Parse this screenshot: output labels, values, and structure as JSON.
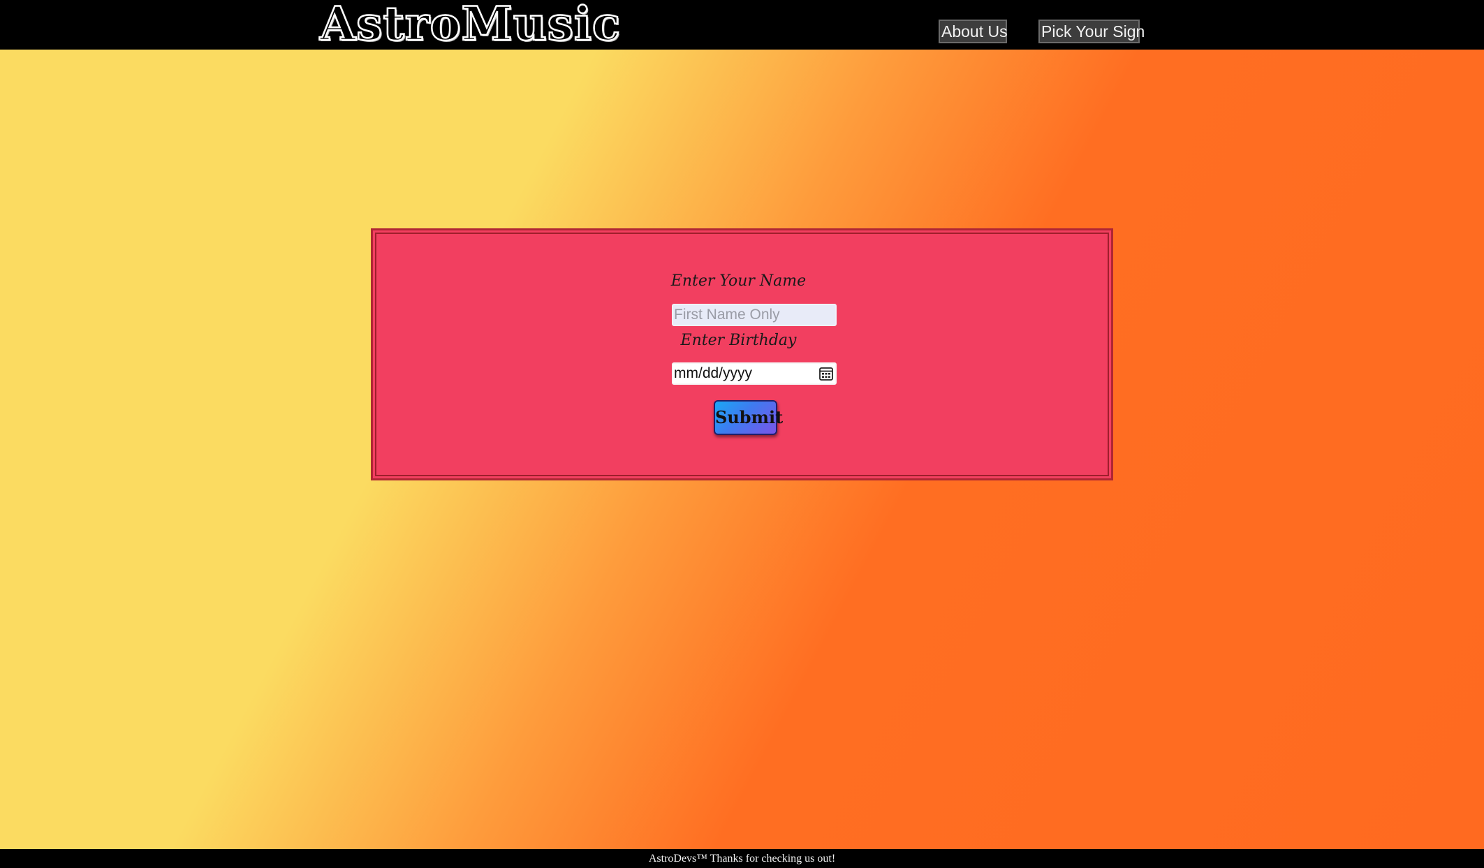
{
  "header": {
    "logo_text": "AstroMusic",
    "nav": {
      "about_label": "About Us",
      "sign_label": "Pick Your Sign"
    }
  },
  "form": {
    "name_label": "Enter Your Name",
    "name_placeholder": "First Name Only",
    "name_value": "",
    "birthday_label": "Enter Birthday",
    "birthday_placeholder": "mm/dd/yyyy",
    "birthday_icon": "calendar-icon",
    "submit_label": "Submit"
  },
  "footer": {
    "text": "AstroDevs™ Thanks for checking us out!"
  },
  "colors": {
    "bar_background": "#000000",
    "page_gradient_start": "#fbdb61",
    "page_gradient_end": "#ff6e22",
    "panel_background": "#f23f60",
    "panel_border": "#b02634",
    "submit_gradient_start": "#1aa7f5",
    "submit_gradient_end": "#7a55e8"
  }
}
